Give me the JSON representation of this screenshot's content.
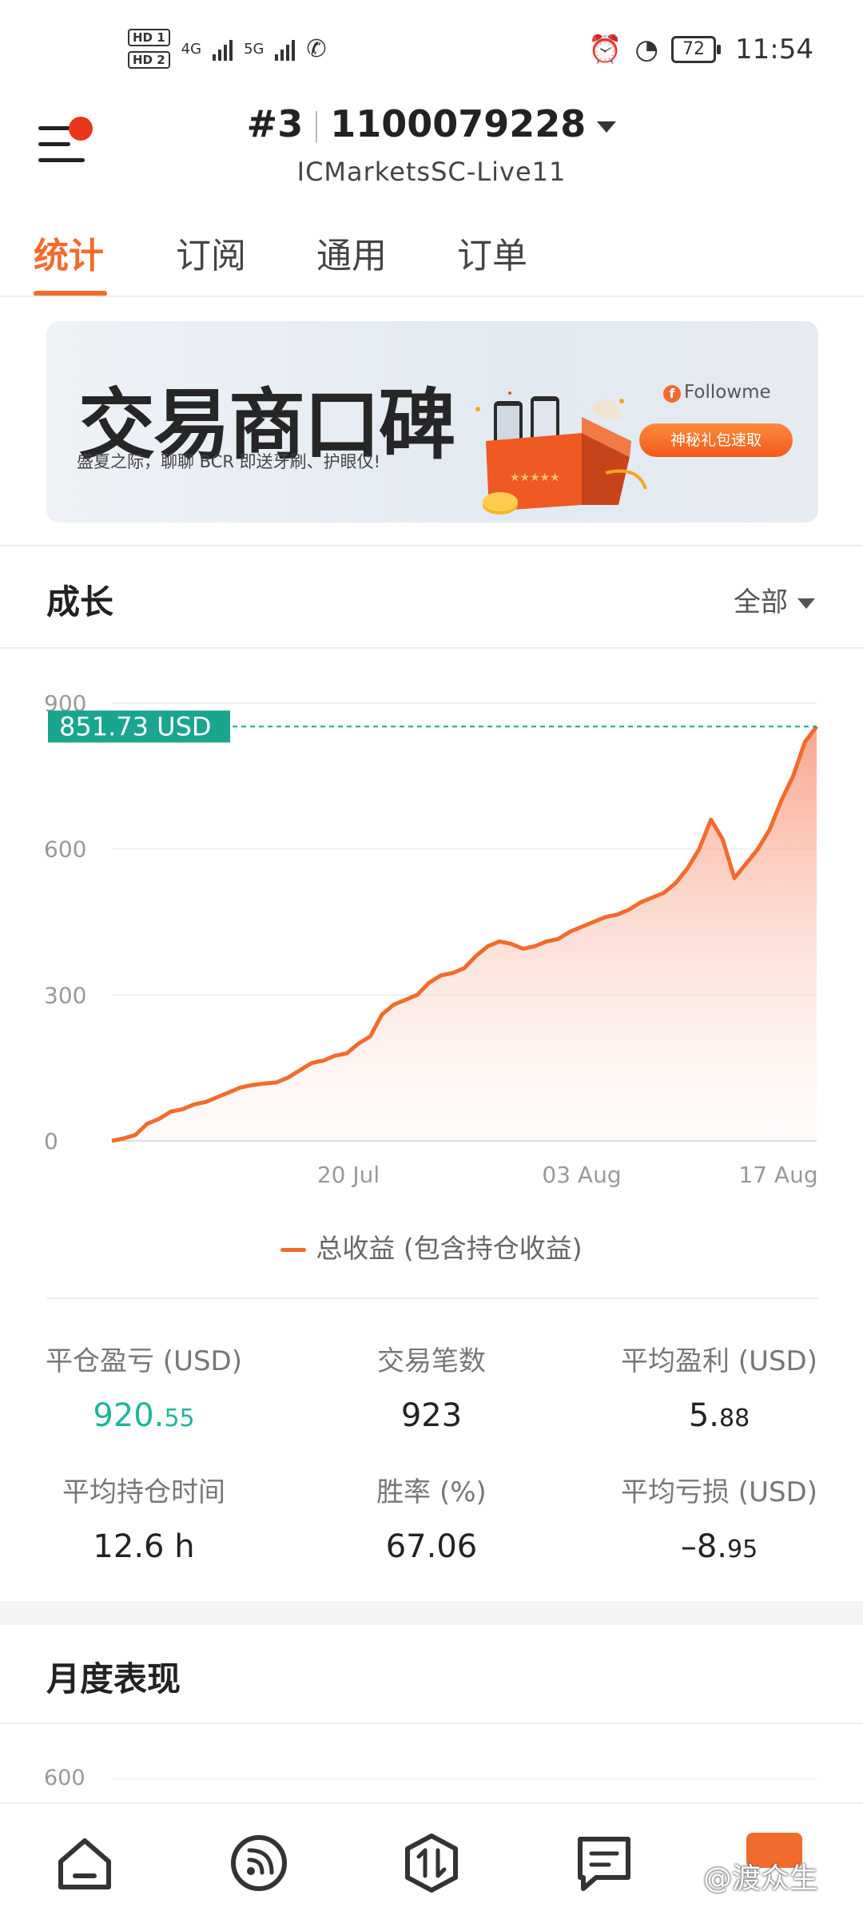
{
  "status_bar": {
    "hd1": "HD 1",
    "hd2": "HD 2",
    "net1": "4G",
    "net2": "5G",
    "battery": "72",
    "time": "11:54"
  },
  "header": {
    "account_index": "#3",
    "account_number": "1100079228",
    "server": "ICMarketsSC-Live11"
  },
  "tabs": [
    {
      "label": "统计",
      "active": true
    },
    {
      "label": "订阅",
      "active": false
    },
    {
      "label": "通用",
      "active": false
    },
    {
      "label": "订单",
      "active": false
    }
  ],
  "banner": {
    "title": "交易商口碑",
    "subtitle": "盛夏之际，聊聊 BCR 即送牙刷、护眼仪!",
    "brand": "Followme",
    "button": "神秘礼包速取"
  },
  "growth": {
    "title": "成长",
    "range": "全部",
    "legend": "总收益 (包含持仓收益)"
  },
  "chart_data": {
    "type": "area",
    "y_ticks": [
      "900",
      "600",
      "300",
      "0"
    ],
    "ylim": [
      0,
      900
    ],
    "x_ticks": [
      "20 Jul",
      "03 Aug",
      "17 Aug"
    ],
    "current_label": "851.73 USD",
    "current_value": 851.73,
    "accent": "#f26b2d",
    "label_color": "#1aa58e",
    "series": [
      {
        "name": "总收益 (包含持仓收益)",
        "values": [
          0,
          5,
          12,
          35,
          45,
          60,
          65,
          75,
          80,
          90,
          100,
          110,
          115,
          118,
          120,
          130,
          145,
          160,
          165,
          175,
          180,
          200,
          215,
          260,
          280,
          290,
          300,
          325,
          340,
          345,
          355,
          380,
          400,
          410,
          405,
          395,
          400,
          410,
          415,
          430,
          440,
          450,
          460,
          465,
          475,
          490,
          500,
          510,
          530,
          560,
          600,
          660,
          620,
          540,
          570,
          600,
          640,
          700,
          750,
          820,
          851.73
        ]
      }
    ]
  },
  "stats": [
    {
      "label": "平仓盈亏 (USD)",
      "value_main": "920.",
      "value_frac": "55",
      "green": true
    },
    {
      "label": "交易笔数",
      "value_main": "923",
      "value_frac": "",
      "green": false
    },
    {
      "label": "平均盈利 (USD)",
      "value_main": "5.",
      "value_frac": "88",
      "green": false
    },
    {
      "label": "平均持仓时间",
      "value_main": "12.6 h",
      "value_frac": "",
      "green": false
    },
    {
      "label": "胜率 (%)",
      "value_main": "67.06",
      "value_frac": "",
      "green": false
    },
    {
      "label": "平均亏损 (USD)",
      "value_main": "–8.",
      "value_frac": "95",
      "green": false
    }
  ],
  "monthly": {
    "title": "月度表现",
    "first_tick": "600"
  },
  "watermark": "@渡众生"
}
